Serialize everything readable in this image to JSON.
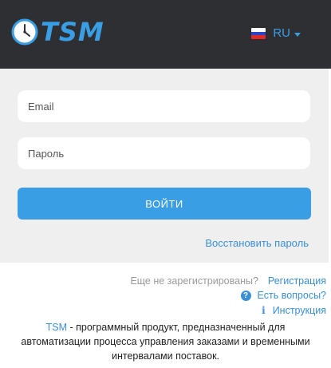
{
  "header": {
    "logo_text": "TSM",
    "language": {
      "code": "RU",
      "flag_colors": [
        "#ffffff",
        "#2a45c6",
        "#e02a2a"
      ]
    }
  },
  "login_form": {
    "email_placeholder": "Email",
    "password_placeholder": "Пароль",
    "submit_label": "ВОЙТИ",
    "restore_password_link": "Восстановить пароль"
  },
  "footer": {
    "not_registered_text": "Еще не зарегистрированы?",
    "register_link": "Регистрация",
    "questions_link": "Есть вопросы?",
    "instruction_link": "Инструкция",
    "description": {
      "brand": "TSM",
      "text": " - программный продукт, предназначенный для автоматизации процесса управления заказами и временными интервалами поставок."
    }
  },
  "icons": {
    "logo": "clock-icon",
    "questions": "question-circle-icon",
    "instruction": "info-icon",
    "language_caret": "caret-down-icon"
  },
  "colors": {
    "header_bg": "#2e2f33",
    "accent": "#3a9ee4",
    "form_bg": "#f0eff0",
    "link": "#3a8fd6",
    "muted_text": "#9a9a9a"
  }
}
